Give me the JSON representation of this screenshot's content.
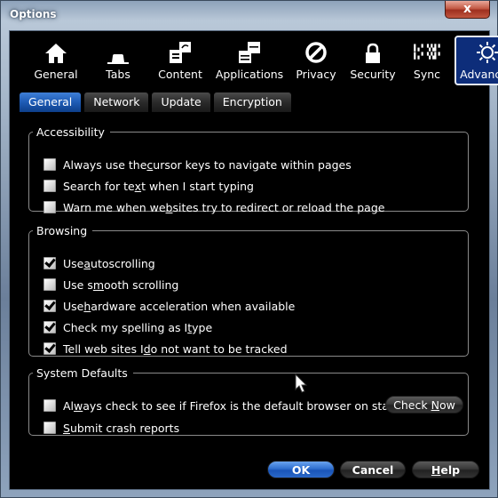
{
  "window": {
    "title": "Options",
    "close_label": "x"
  },
  "panes": [
    {
      "id": "general",
      "label": "General",
      "icon": "home-icon",
      "selected": false
    },
    {
      "id": "tabs",
      "label": "Tabs",
      "icon": "tabs-icon",
      "selected": false
    },
    {
      "id": "content",
      "label": "Content",
      "icon": "content-icon",
      "selected": false
    },
    {
      "id": "applications",
      "label": "Applications",
      "icon": "applications-icon",
      "selected": false
    },
    {
      "id": "privacy",
      "label": "Privacy",
      "icon": "privacy-icon",
      "selected": false
    },
    {
      "id": "security",
      "label": "Security",
      "icon": "lock-icon",
      "selected": false
    },
    {
      "id": "sync",
      "label": "Sync",
      "icon": "sync-icon",
      "selected": false
    },
    {
      "id": "advanced",
      "label": "Advanced",
      "icon": "gear-icon",
      "selected": true
    }
  ],
  "subtabs": [
    {
      "label": "General",
      "selected": true
    },
    {
      "label": "Network",
      "selected": false
    },
    {
      "label": "Update",
      "selected": false
    },
    {
      "label": "Encryption",
      "selected": false
    }
  ],
  "accessibility": {
    "title": "Accessibility",
    "items": [
      {
        "pre": "Always use the ",
        "key": "c",
        "post": "ursor keys to navigate within pages",
        "checked": false
      },
      {
        "pre": "Search for te",
        "key": "x",
        "post": "t when I start typing",
        "checked": false
      },
      {
        "pre": "Warn me when we",
        "key": "b",
        "post": " sites try to redirect or reload the page",
        "checked": false
      }
    ]
  },
  "browsing": {
    "title": "Browsing",
    "items": [
      {
        "pre": "Use ",
        "key": "a",
        "post": "utoscrolling",
        "checked": true
      },
      {
        "pre": "Use s",
        "key": "m",
        "post": "ooth scrolling",
        "checked": false
      },
      {
        "pre": "Use ",
        "key": "h",
        "post": "ardware acceleration when available",
        "checked": true
      },
      {
        "pre": "Check my spelling as I ",
        "key": "t",
        "post": "ype",
        "checked": true
      },
      {
        "pre": "Tell web sites I ",
        "key": "d",
        "post": "o not want to be tracked",
        "checked": true
      }
    ]
  },
  "system_defaults": {
    "title": "System Defaults",
    "items": [
      {
        "pre": "Al",
        "key": "w",
        "post": "ays check to see if Firefox is the default browser on startup",
        "checked": false
      },
      {
        "pre": "",
        "key": "S",
        "post": "ubmit crash reports",
        "checked": false
      }
    ],
    "check_now": {
      "pre": "Check ",
      "key": "N",
      "post": "ow"
    }
  },
  "buttons": {
    "ok": "OK",
    "cancel": "Cancel",
    "help_key": "H",
    "help_rest": "elp"
  }
}
